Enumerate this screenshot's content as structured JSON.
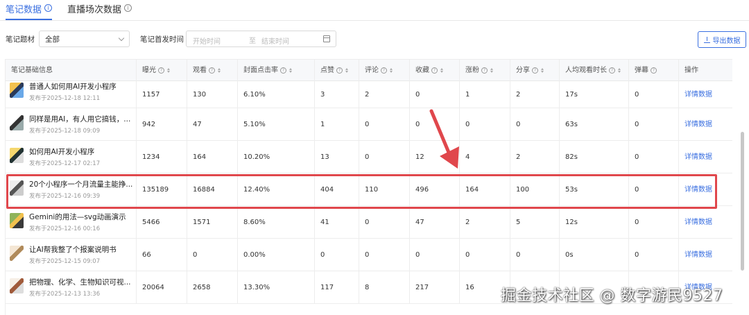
{
  "tabs": [
    {
      "label": "笔记数据",
      "active": true
    },
    {
      "label": "直播场次数据",
      "active": false
    }
  ],
  "filters": {
    "topic_label": "笔记题材",
    "topic_value": "全部",
    "time_label": "笔记首发时间",
    "start_placeholder": "开始时间",
    "separator": "至",
    "end_placeholder": "结束时间",
    "export_label": "导出数据"
  },
  "table": {
    "headers": [
      "笔记基础信息",
      "曝光",
      "观看",
      "封面点击率",
      "点赞",
      "评论",
      "收藏",
      "涨粉",
      "分享",
      "人均观看时长",
      "弹幕",
      "操作"
    ],
    "rows": [
      {
        "title": "普通人如何用AI开发小程序",
        "date": "发布于2025-12-18 12:11",
        "values": [
          "1157",
          "130",
          "6.10%",
          "3",
          "2",
          "0",
          "1",
          "2",
          "17s",
          "0"
        ],
        "action": "详情数据"
      },
      {
        "title": "同样是用AI，有人用它搞钱，...",
        "date": "发布于2025-12-18 09:09",
        "values": [
          "942",
          "47",
          "5.10%",
          "1",
          "0",
          "0",
          "0",
          "0",
          "63s",
          "0"
        ],
        "action": "详情数据"
      },
      {
        "title": "如何用AI开发小程序",
        "date": "发布于2025-12-17 02:17",
        "values": [
          "1234",
          "164",
          "10.20%",
          "13",
          "0",
          "12",
          "4",
          "2",
          "82s",
          "0"
        ],
        "action": "详情数据"
      },
      {
        "title": "20个小程序一个月流量主能挣...",
        "date": "发布于2025-12-16 09:39",
        "values": [
          "135189",
          "16884",
          "12.40%",
          "404",
          "110",
          "496",
          "164",
          "100",
          "53s",
          "0"
        ],
        "action": "详情数据"
      },
      {
        "title": "Gemini的用法—svg动画演示",
        "date": "发布于2025-12-16 00:16",
        "values": [
          "5466",
          "1571",
          "8.60%",
          "41",
          "0",
          "47",
          "2",
          "5",
          "12s",
          "0"
        ],
        "action": "详情数据"
      },
      {
        "title": "让AI帮我整了个报案说明书",
        "date": "发布于2025-12-15 09:07",
        "values": [
          "66",
          "0",
          "0.00%",
          "0",
          "0",
          "0",
          "0",
          "0",
          "0s",
          "0"
        ],
        "action": "详情数据"
      },
      {
        "title": "把物理、化学、生物知识可视...",
        "date": "发布于2025-12-13 13:36",
        "values": [
          "20064",
          "2658",
          "13.30%",
          "117",
          "8",
          "217",
          "16",
          "",
          "",
          ""
        ],
        "action": "详情数据"
      }
    ]
  },
  "watermark": "掘金技术社区 @ 数字游民9527",
  "colors": {
    "accent": "#3a6fe0",
    "highlight": "#e0474c"
  }
}
